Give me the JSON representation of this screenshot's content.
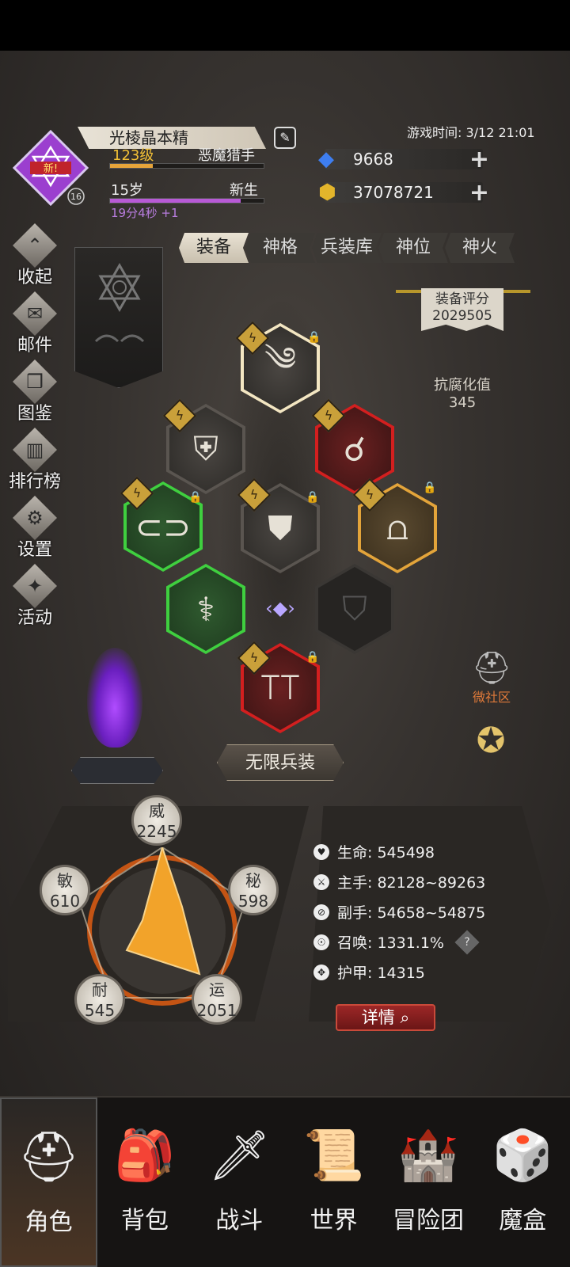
{
  "player": {
    "name": "光棱晶本精",
    "level": "123级",
    "class": "恶魔猎手",
    "age": "15岁",
    "stage": "新生",
    "timer": "19分4秒 +1",
    "badge_new": "新!",
    "avatar_rank": "16",
    "level_progress": 0.28,
    "age_progress": 0.85
  },
  "game_time": "游戏时间: 3/12 21:01",
  "currency": {
    "gems": "9668",
    "gold": "37078721"
  },
  "tabs": [
    "装备",
    "神格",
    "兵装库",
    "神位",
    "神火"
  ],
  "side_menu": [
    "收起",
    "邮件",
    "图鉴",
    "排行榜",
    "设置",
    "活动"
  ],
  "score": {
    "label": "装备评分",
    "value": "2029505"
  },
  "corruption": {
    "label": "抗腐化值",
    "value": "345"
  },
  "infinite_button": "无限兵装",
  "attributes": {
    "wei": {
      "label": "威",
      "value": "2245"
    },
    "mi": {
      "label": "秘",
      "value": "598"
    },
    "yun": {
      "label": "运",
      "value": "2051"
    },
    "nai": {
      "label": "耐",
      "value": "545"
    },
    "min": {
      "label": "敏",
      "value": "610"
    }
  },
  "stats": {
    "hp": "生命: 545498",
    "main_hand": "主手: 82128~89263",
    "off_hand": "副手: 54658~54875",
    "summon": "召唤: 1331.1%",
    "armor": "护甲: 14315"
  },
  "detail_button": "详情",
  "community_label": "微社区",
  "bottom_nav": [
    "角色",
    "背包",
    "战斗",
    "世界",
    "冒险团",
    "魔盒"
  ],
  "colors": {
    "level_bar": "#e6a43a",
    "age_bar": "#b85ad6",
    "gold_text": "#f3c136",
    "purple_text": "#b97de0",
    "rare_green": "#3fcf3f",
    "epic_red": "#d31f1f",
    "legend_gold": "#e3a43a",
    "glow_white": "#f3e6c2"
  }
}
